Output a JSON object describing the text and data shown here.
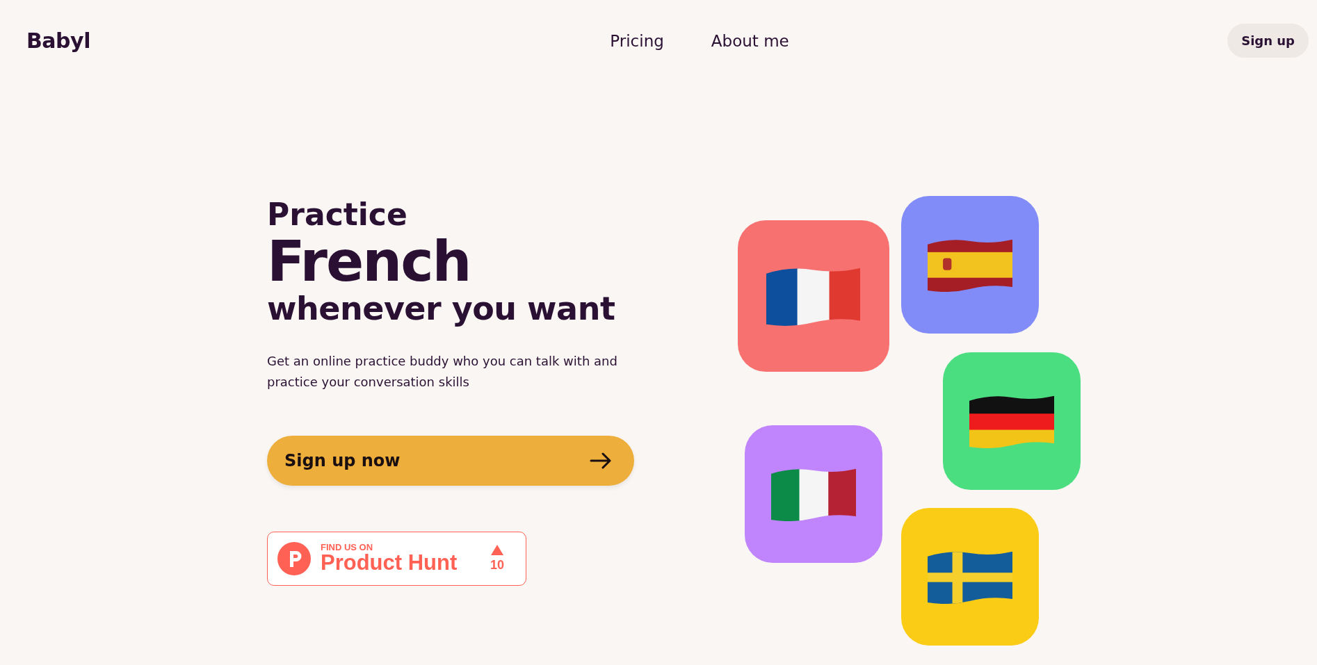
{
  "header": {
    "logo": "Babyl",
    "nav": [
      "Pricing",
      "About me"
    ],
    "signup": "Sign up"
  },
  "hero": {
    "line1": "Practice",
    "language": "French",
    "line3": "whenever you want",
    "description": "Get an online practice buddy who you can talk with and practice your conversation skills",
    "cta": "Sign up now"
  },
  "badge": {
    "eyebrow": "FIND US ON",
    "name": "Product Hunt",
    "votes": "10"
  },
  "tiles": [
    {
      "kind": "france",
      "color": "#f87171"
    },
    {
      "kind": "spain",
      "color": "#818cf8"
    },
    {
      "kind": "germany",
      "color": "#4ade80"
    },
    {
      "kind": "italy",
      "color": "#c084fc"
    },
    {
      "kind": "sweden",
      "color": "#facc15"
    }
  ]
}
